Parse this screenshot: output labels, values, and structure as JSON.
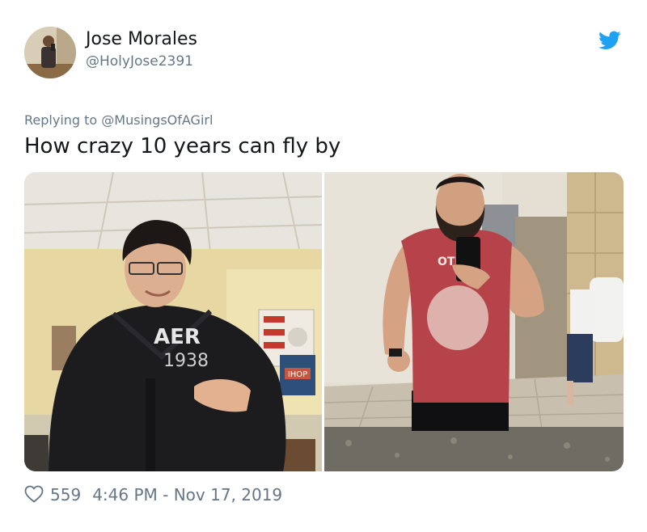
{
  "tweet": {
    "author": {
      "display_name": "Jose Morales",
      "handle": "@HolyJose2391"
    },
    "reply": {
      "prefix": "Replying to",
      "mention": "@MusingsOfAGirl"
    },
    "text": "How crazy 10 years can fly by",
    "likes": "559",
    "timestamp": "4:46 PM - Nov 17, 2019",
    "photo_captions": {
      "shirt_left": "AER",
      "shirt_number": "1938",
      "ihop_sign": "IHOP",
      "shirt_right": "OTI"
    }
  },
  "icons": {
    "brand": "twitter-bird-icon",
    "like": "heart-outline-icon"
  },
  "colors": {
    "twitter_blue": "#1da1f2",
    "secondary_text": "#657786",
    "primary_text": "#14171a"
  }
}
